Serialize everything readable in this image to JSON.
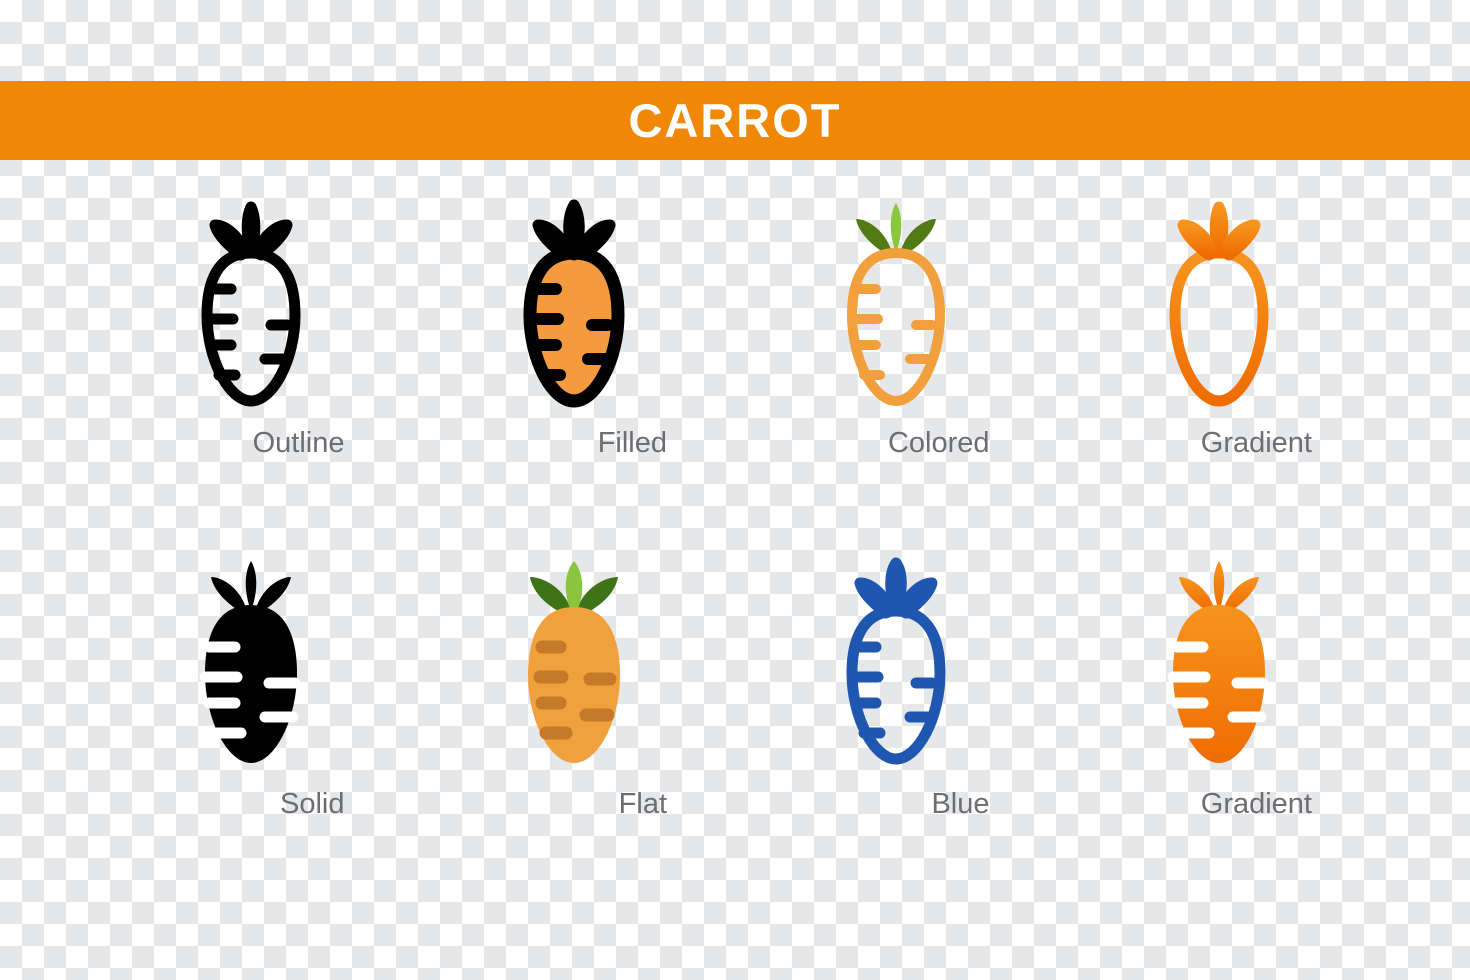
{
  "banner": {
    "title": "CARROT",
    "background_color": "#f08705",
    "text_color": "#ffffff"
  },
  "canvas": {
    "background": "transparent-checkerboard",
    "checker_light": "#ffffff",
    "checker_dark": "#e6e7e8",
    "checker_size_px": 22
  },
  "label_color": "#6d6e71",
  "icons": [
    {
      "id": "carrot-outline",
      "label": "Outline",
      "style": "outline",
      "stroke_color": "#000000",
      "body_fill": "none",
      "leaf_fill": "none",
      "leaf_stroke": "#000000",
      "tick_color": "#000000"
    },
    {
      "id": "carrot-filled",
      "label": "Filled",
      "style": "filled",
      "stroke_color": "#000000",
      "body_fill": "#f49a3f",
      "leaf_fill": "#8cc63f",
      "leaf_stroke": "#000000",
      "tick_color": "#000000"
    },
    {
      "id": "carrot-colored",
      "label": "Colored",
      "style": "colored",
      "stroke_color": "#f2a03d",
      "body_fill": "none",
      "leaf_fill": "#8cc63f",
      "leaf_side_fill": "#4f7a16",
      "tick_color": "#f2a03d"
    },
    {
      "id": "carrot-gradient-outline",
      "label": "Gradient",
      "style": "gradient-outline",
      "stroke_color": "#f07d12",
      "gradient_from": "#f7941e",
      "gradient_to": "#ef6c00",
      "body_fill": "none",
      "tick_color": "#f07d12"
    },
    {
      "id": "carrot-solid",
      "label": "Solid",
      "style": "solid",
      "stroke_color": "#000000",
      "body_fill": "#000000",
      "leaf_fill": "#000000",
      "tick_color": "#ffffff"
    },
    {
      "id": "carrot-flat",
      "label": "Flat",
      "style": "flat",
      "stroke_color": "none",
      "body_fill": "#f0a03c",
      "leaf_fill": "#8bc53f",
      "leaf_side_fill": "#3e7317",
      "tick_color": "#c47a28"
    },
    {
      "id": "carrot-blue",
      "label": "Blue",
      "style": "blue",
      "stroke_color": "#1e56b0",
      "body_fill": "none",
      "leaf_fill": "#a8dff0",
      "leaf_stroke": "#1e56b0",
      "tick_color": "#1e56b0"
    },
    {
      "id": "carrot-gradient-solid",
      "label": "Gradient",
      "style": "gradient-solid",
      "stroke_color": "none",
      "gradient_from": "#f7941e",
      "gradient_to": "#ef6c00",
      "body_fill": "gradient",
      "leaf_fill": "gradient",
      "tick_color": "#ffffff"
    }
  ]
}
